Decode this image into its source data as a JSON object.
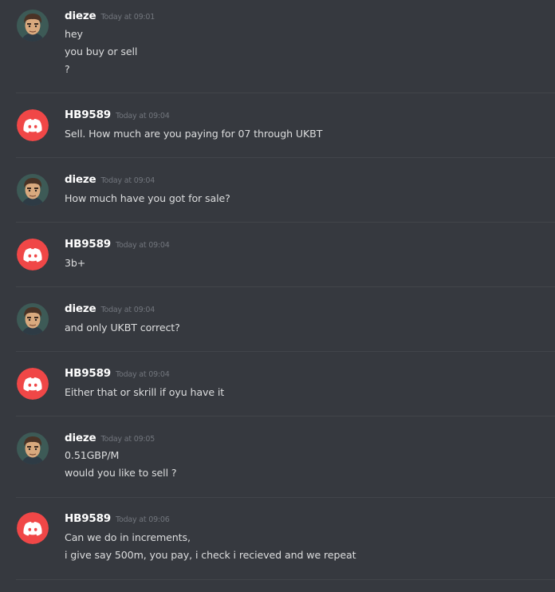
{
  "messages": [
    {
      "username": "dieze",
      "timestamp": "Today at 09:01",
      "avatar": "dieze-avatar",
      "lines": [
        "hey",
        "you buy or sell",
        "?"
      ]
    },
    {
      "username": "HB9589",
      "timestamp": "Today at 09:04",
      "avatar": "discord-logo-avatar",
      "lines": [
        "Sell. How much are you paying for 07 through UKBT"
      ]
    },
    {
      "username": "dieze",
      "timestamp": "Today at 09:04",
      "avatar": "dieze-avatar",
      "lines": [
        "How much have you got for sale?"
      ]
    },
    {
      "username": "HB9589",
      "timestamp": "Today at 09:04",
      "avatar": "discord-logo-avatar",
      "lines": [
        "3b+"
      ]
    },
    {
      "username": "dieze",
      "timestamp": "Today at 09:04",
      "avatar": "dieze-avatar",
      "lines": [
        "and only UKBT correct?"
      ]
    },
    {
      "username": "HB9589",
      "timestamp": "Today at 09:04",
      "avatar": "discord-logo-avatar",
      "lines": [
        "Either that or skrill if oyu have it"
      ]
    },
    {
      "username": "dieze",
      "timestamp": "Today at 09:05",
      "avatar": "dieze-avatar",
      "lines": [
        "0.51GBP/M",
        "would you like to sell ?"
      ]
    },
    {
      "username": "HB9589",
      "timestamp": "Today at 09:06",
      "avatar": "discord-logo-avatar",
      "lines": [
        "Can we do in increments,",
        "i give say 500m, you pay, i check i recieved and we repeat"
      ]
    }
  ],
  "colors": {
    "background": "#36393f",
    "divider": "#42454a",
    "username": "#ffffff",
    "timestamp": "#72767d",
    "text": "#dcddde",
    "discord_avatar_bg": "#f04747"
  }
}
